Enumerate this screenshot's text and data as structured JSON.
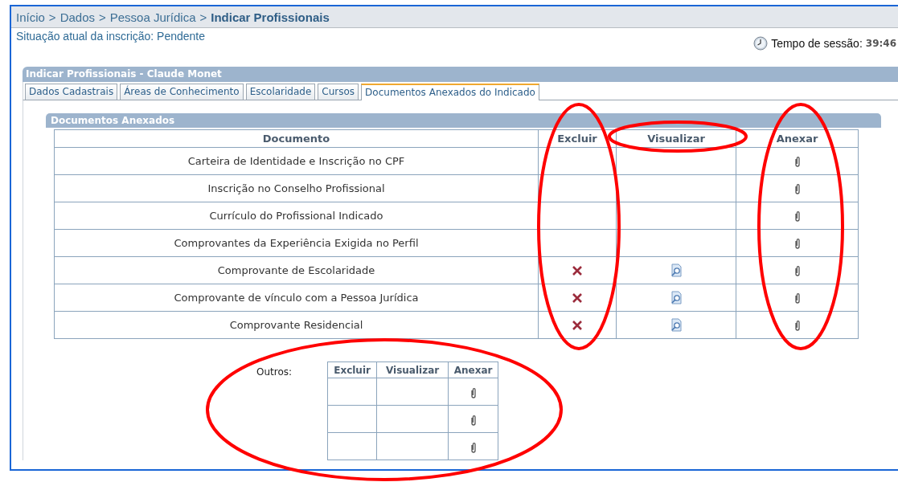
{
  "breadcrumb": {
    "items": [
      "Início",
      "Dados",
      "Pessoa Jurídica"
    ],
    "separator": ">",
    "current": "Indicar Profissionais"
  },
  "status": {
    "label": "Situação atual da inscrição:",
    "value": "Pendente"
  },
  "session": {
    "label": "Tempo de sessão:",
    "time": "39:46"
  },
  "panel": {
    "title": "Indicar Profissionais - Claude Monet",
    "tabs": [
      {
        "label": "Dados Cadastrais",
        "selected": false
      },
      {
        "label": "Áreas de Conhecimento",
        "selected": false
      },
      {
        "label": "Escolaridade",
        "selected": false
      },
      {
        "label": "Cursos",
        "selected": false
      },
      {
        "label": "Documentos Anexados do Indicado",
        "selected": true
      }
    ],
    "section": {
      "title": "Documentos Anexados",
      "columns": [
        "Documento",
        "Excluir",
        "Visualizar",
        "Anexar"
      ],
      "rows": [
        {
          "document": "Carteira de Identidade e Inscrição no CPF",
          "attached": false
        },
        {
          "document": "Inscrição no Conselho Profissional",
          "attached": false
        },
        {
          "document": "Currículo do Profissional Indicado",
          "attached": false
        },
        {
          "document": "Comprovantes da Experiência Exigida no Perfil",
          "attached": false
        },
        {
          "document": "Comprovante de Escolaridade",
          "attached": true
        },
        {
          "document": "Comprovante de vínculo com a Pessoa Jurídica",
          "attached": true
        },
        {
          "document": "Comprovante Residencial",
          "attached": true
        }
      ]
    },
    "others": {
      "label": "Outros:",
      "columns": [
        "Excluir",
        "Visualizar",
        "Anexar"
      ],
      "rows": [
        {
          "attached": false
        },
        {
          "attached": false
        },
        {
          "attached": false
        }
      ]
    }
  }
}
